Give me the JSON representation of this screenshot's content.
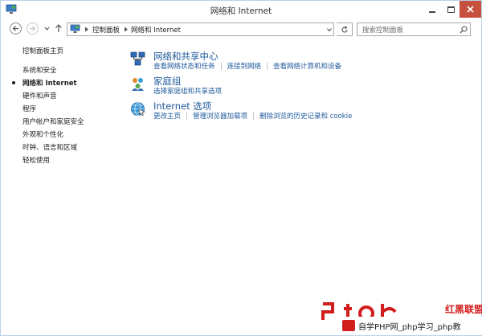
{
  "window": {
    "title": "网络和 Internet"
  },
  "address_bar": {
    "crumbs": [
      "控制面板",
      "网络和 Internet"
    ],
    "search_placeholder": "搜索控制面板"
  },
  "sidebar": {
    "items": [
      {
        "label": "控制面板主页",
        "active": false
      },
      {
        "label": "系统和安全",
        "active": false
      },
      {
        "label": "网络和 Internet",
        "active": true
      },
      {
        "label": "硬件和声音",
        "active": false
      },
      {
        "label": "程序",
        "active": false
      },
      {
        "label": "用户帐户和家庭安全",
        "active": false
      },
      {
        "label": "外观和个性化",
        "active": false
      },
      {
        "label": "时钟、语言和区域",
        "active": false
      },
      {
        "label": "轻松使用",
        "active": false
      }
    ]
  },
  "categories": [
    {
      "title": "网络和共享中心",
      "icon": "network-sharing-icon",
      "links": [
        "查看网络状态和任务",
        "连接到网络",
        "查看网络计算机和设备"
      ]
    },
    {
      "title": "家庭组",
      "icon": "homegroup-icon",
      "links": [
        "选择家庭组和共享选项"
      ]
    },
    {
      "title": "Internet 选项",
      "icon": "internet-options-icon",
      "links": [
        "更改主页",
        "管理浏览器加载项",
        "删除浏览的历史记录和 cookie"
      ]
    }
  ],
  "watermark": {
    "brand": "红黑联盟",
    "text": "自学PHP网_php学习_php教"
  },
  "colors": {
    "link": "#1e5a9c",
    "close_button": "#c7503e",
    "watermark_red": "#d21d1d"
  }
}
